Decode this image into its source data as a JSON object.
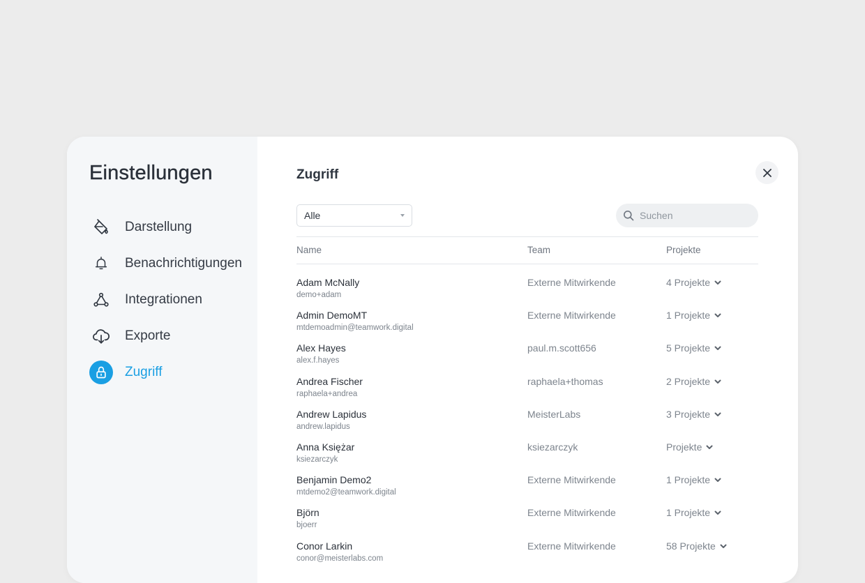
{
  "sidebar": {
    "title": "Einstellungen",
    "items": [
      {
        "label": "Darstellung",
        "icon": "paint-bucket-icon"
      },
      {
        "label": "Benachrichtigungen",
        "icon": "bell-icon"
      },
      {
        "label": "Integrationen",
        "icon": "integrations-icon"
      },
      {
        "label": "Exporte",
        "icon": "cloud-download-icon"
      },
      {
        "label": "Zugriff",
        "icon": "lock-icon",
        "active": true
      }
    ]
  },
  "main": {
    "title": "Zugriff",
    "filter": {
      "value": "Alle"
    },
    "search": {
      "placeholder": "Suchen"
    },
    "columns": {
      "name": "Name",
      "team": "Team",
      "projects": "Projekte"
    },
    "rows": [
      {
        "name": "Adam McNally",
        "email": "demo+adam",
        "team": "Externe Mitwirkende",
        "projects": "4 Projekte"
      },
      {
        "name": "Admin DemoMT",
        "email": "mtdemoadmin@teamwork.digital",
        "team": "Externe Mitwirkende",
        "projects": "1 Projekte"
      },
      {
        "name": "Alex Hayes",
        "email": "alex.f.hayes",
        "team": "paul.m.scott656",
        "projects": "5 Projekte"
      },
      {
        "name": "Andrea Fischer",
        "email": "raphaela+andrea",
        "team": "raphaela+thomas",
        "projects": "2 Projekte"
      },
      {
        "name": "Andrew Lapidus",
        "email": "andrew.lapidus",
        "team": "MeisterLabs",
        "projects": "3 Projekte"
      },
      {
        "name": "Anna Księżar",
        "email": "ksiezarczyk",
        "team": "ksiezarczyk",
        "projects": "Projekte"
      },
      {
        "name": "Benjamin Demo2",
        "email": "mtdemo2@teamwork.digital",
        "team": "Externe Mitwirkende",
        "projects": "1 Projekte"
      },
      {
        "name": "Björn",
        "email": "bjoerr",
        "team": "Externe Mitwirkende",
        "projects": "1 Projekte"
      },
      {
        "name": "Conor Larkin",
        "email": "conor@meisterlabs.com",
        "team": "Externe Mitwirkende",
        "projects": "58 Projekte"
      }
    ]
  },
  "colors": {
    "accent": "#1a9fe3",
    "background": "#ececec",
    "sidebar_bg": "#f5f7f9"
  }
}
